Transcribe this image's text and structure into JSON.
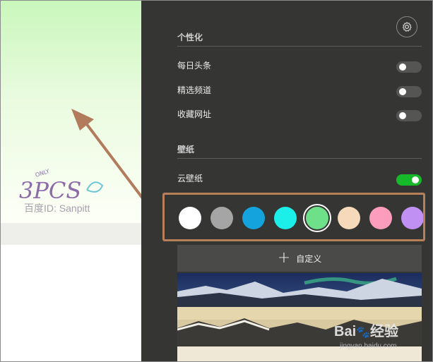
{
  "watermark": {
    "logo_text": "3PCS",
    "small_text": "ONLY",
    "id_text": "百度ID: Sanpitt"
  },
  "settings": {
    "icon": "gear-icon"
  },
  "sections": {
    "personalize": {
      "title": "个性化",
      "items": [
        {
          "label": "每日头条",
          "enabled": false
        },
        {
          "label": "精选频道",
          "enabled": false
        },
        {
          "label": "收藏网址",
          "enabled": false
        }
      ]
    },
    "wallpaper": {
      "title": "壁纸",
      "cloud": {
        "label": "云壁纸",
        "enabled": true
      }
    }
  },
  "colors": {
    "swatches": [
      "#ffffff",
      "#a5a5a5",
      "#14a3dc",
      "#1cefea",
      "#6ee08a",
      "#f6d8bb",
      "#fd9dbd",
      "#c090f2"
    ],
    "selected_index": 4,
    "highlight": "#b8805a"
  },
  "custom": {
    "label": "自定义"
  },
  "footer_watermark": {
    "brand": "Bai",
    "suffix": "经验",
    "url": "jingyan.baidu.com"
  },
  "accent": {
    "toggle_on": "#16b92a",
    "panel_bg": "#353534"
  }
}
